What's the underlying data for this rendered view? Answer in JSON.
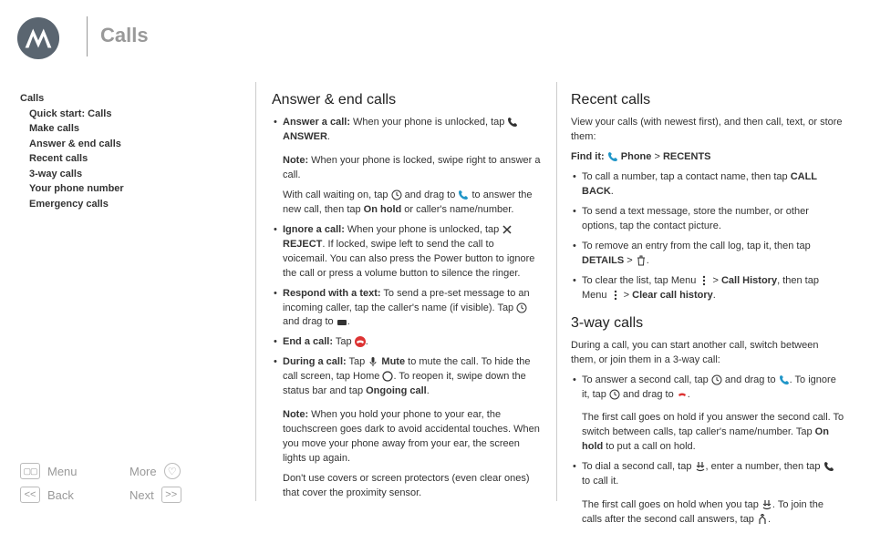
{
  "title": "Calls",
  "sidebar": {
    "root": "Calls",
    "items": [
      "Quick start: Calls",
      "Make calls",
      "Answer & end calls",
      "Recent calls",
      "3-way calls",
      "Your phone number",
      "Emergency calls"
    ]
  },
  "nav": {
    "menu": "Menu",
    "more": "More",
    "back": "Back",
    "next": "Next"
  },
  "col1": {
    "h": "Answer & end calls",
    "answer_b": "Answer a call:",
    "answer_t": " When your phone is unlocked, tap ",
    "answer_lbl": " ANSWER",
    "note1b": "Note:",
    "note1": " When your phone is locked, swipe right to answer a call.",
    "wait1": "With call waiting on, tap ",
    "wait2": " and drag to ",
    "wait3": " to answer the new call, then tap ",
    "onhold": "On hold",
    "wait4": " or caller's name/number.",
    "ignore_b": "Ignore a call:",
    "ignore1": " When your phone is unlocked, tap ",
    "reject": " REJECT",
    "ignore2": ". If locked, swipe left to send the call to voicemail. You can also press the Power button to ignore the call or press a volume button to silence the ringer.",
    "respond_b": "Respond with a text:",
    "respond1": " To send a pre-set message to an incoming caller, tap the caller's name (if visible). Tap ",
    "respond2": " and drag to ",
    "end_b": "End a call:",
    "end_t": " Tap ",
    "during_b": "During a call:",
    "during1": " Tap ",
    "mute": " Mute",
    "during2": " to mute the call. To hide the call screen, tap Home ",
    "during3": ". To reopen it, swipe down the status bar and tap ",
    "ongoing": "Ongoing call",
    "note2b": "Note:",
    "note2": " When you hold your phone to your ear, the touchscreen goes dark to avoid accidental touches. When you move your phone away from your ear, the screen lights up again.",
    "note3": "Don't use covers or screen protectors (even clear ones) that cover the proximity sensor."
  },
  "col2": {
    "h1": "Recent calls",
    "intro": "View your calls (with newest first), and then call, text, or store them:",
    "find_b": "Find it:",
    "phone": " Phone",
    "arrow": " > ",
    "recents": "RECENTS",
    "r1a": "To call a number, tap a contact name, then tap ",
    "callback": "CALL BACK",
    "r2": "To send a text message, store the number, or other options, tap the contact picture.",
    "r3a": "To remove an entry from the call log, tap it, then tap ",
    "details": "DETAILS",
    "r4a": "To clear the list, tap Menu ",
    "callhist": "Call History",
    "r4b": ", then tap Menu ",
    "clearhist": "Clear call history",
    "h2": "3-way calls",
    "intro2": "During a call, you can start another call, switch between them, or join them in a 3-way call:",
    "w1a": "To answer a second call, tap ",
    "w1b": " and drag to ",
    "w1c": ". To ignore it, tap ",
    "w1d": " and drag to ",
    "w2a": "The first call goes on hold if you answer the second call. To switch between calls, tap caller's name/number. Tap ",
    "w2b": " to put a call on hold.",
    "w3a": "To dial a second call, tap ",
    "w3b": ", enter a number, then tap ",
    "w3c": " to call it.",
    "w4a": "The first call goes on hold when you tap ",
    "w4b": ". To join the calls after the second call answers, tap "
  }
}
